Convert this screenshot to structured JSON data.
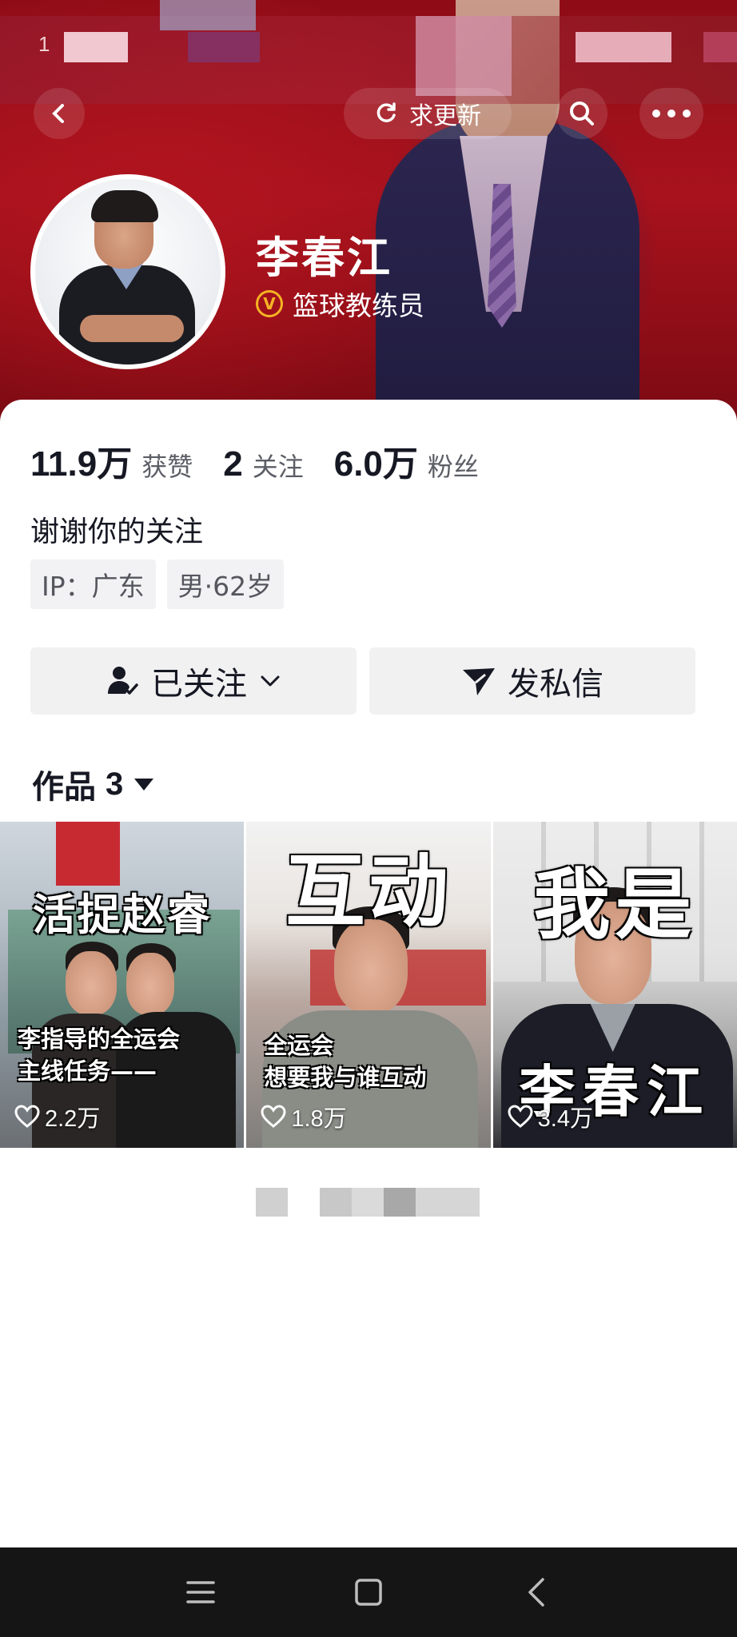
{
  "header": {
    "status_mark": "1",
    "update_label": "求更新"
  },
  "profile": {
    "name": "李春江",
    "verify_badge": "V",
    "verify_text": "篮球教练员",
    "bio": "谢谢你的关注",
    "tags": [
      "IP：广东",
      "男·62岁"
    ]
  },
  "stats": [
    {
      "value": "11.9万",
      "label": "获赞"
    },
    {
      "value": "2",
      "label": "关注"
    },
    {
      "value": "6.0万",
      "label": "粉丝"
    }
  ],
  "actions": {
    "followed_label": "已关注",
    "message_label": "发私信"
  },
  "works": {
    "title": "作品",
    "count": "3",
    "items": [
      {
        "overlay_top": "活捉赵睿",
        "overlay_caption_1": "李指导的全运会",
        "overlay_caption_2": "主线任务——",
        "likes": "2.2万"
      },
      {
        "overlay_top": "互动",
        "overlay_caption_1": "全运会",
        "overlay_caption_2": "想要我与谁互动",
        "likes": "1.8万"
      },
      {
        "overlay_top": "我是",
        "overlay_caption_1": "李春江",
        "overlay_caption_2": "",
        "likes": "3.4万"
      }
    ]
  },
  "colors": {
    "banner_red": "#a8121d",
    "verify_gold": "#f5b324",
    "button_gray": "#f1f1f2",
    "text_primary": "#161823"
  },
  "icons": {
    "back": "back-arrow-icon",
    "update": "refresh-icon",
    "search": "search-icon",
    "more": "more-dots-icon",
    "verified": "verified-badge-icon",
    "followed": "user-check-icon",
    "chevron": "chevron-down-icon",
    "message": "send-icon",
    "works_dropdown": "caret-down-icon",
    "like": "heart-icon",
    "nav_menu": "menu-icon",
    "nav_home": "square-home-icon",
    "nav_back": "back-chevron-icon"
  }
}
